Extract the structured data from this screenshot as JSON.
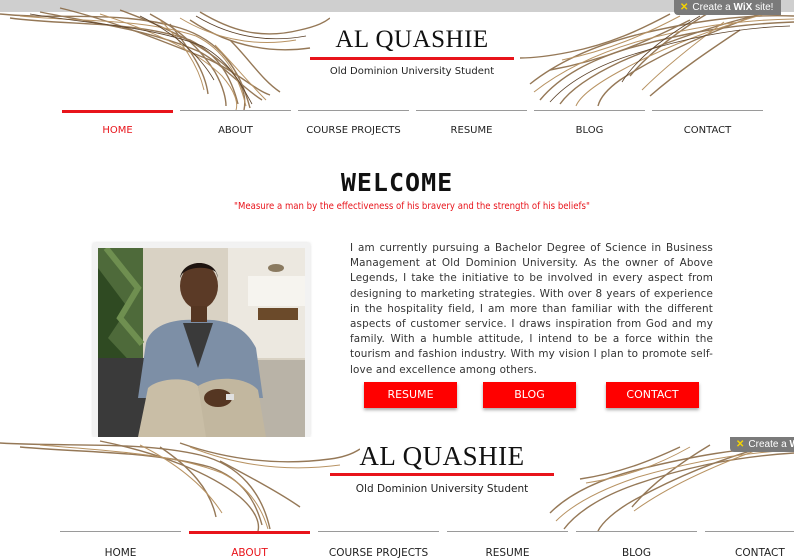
{
  "wix_badge": {
    "prefix": "Create a",
    "brand": "WiX",
    "suffix": "site!"
  },
  "header": {
    "title": "AL QUASHIE",
    "subtitle": "Old Dominion University Student"
  },
  "nav": {
    "items": [
      {
        "label": "HOME"
      },
      {
        "label": "ABOUT"
      },
      {
        "label": "COURSE PROJECTS"
      },
      {
        "label": "RESUME"
      },
      {
        "label": "BLOG"
      },
      {
        "label": "CONTACT"
      }
    ],
    "active_first_view": "HOME",
    "active_second_view": "ABOUT"
  },
  "main": {
    "heading": "WELCOME",
    "quote": "\"Measure a man by the effectiveness of his bravery and the strength of his beliefs\"",
    "bio": "I am currently pursuing a Bachelor Degree of Science in Business Management at Old Dominion University. As the owner of Above Legends, I take the initiative to be involved in every aspect from designing to marketing strategies. With over 8 years of experience in the hospitality field, I am more than familiar with the different aspects of customer service. I draws inspiration from God and my family. With a humble attitude, I intend to be a force within the tourism and fashion industry.  With my vision I plan to promote self-love and excellence among others.",
    "buttons": [
      {
        "label": "RESUME"
      },
      {
        "label": "BLOG"
      },
      {
        "label": "CONTACT"
      }
    ]
  },
  "second_view": {
    "wix_badge": {
      "prefix": "Create a",
      "brand": "W"
    }
  },
  "colors": {
    "accent": "#e8141b",
    "button": "#ff0000",
    "nav_bar": "#9a9a9a"
  }
}
